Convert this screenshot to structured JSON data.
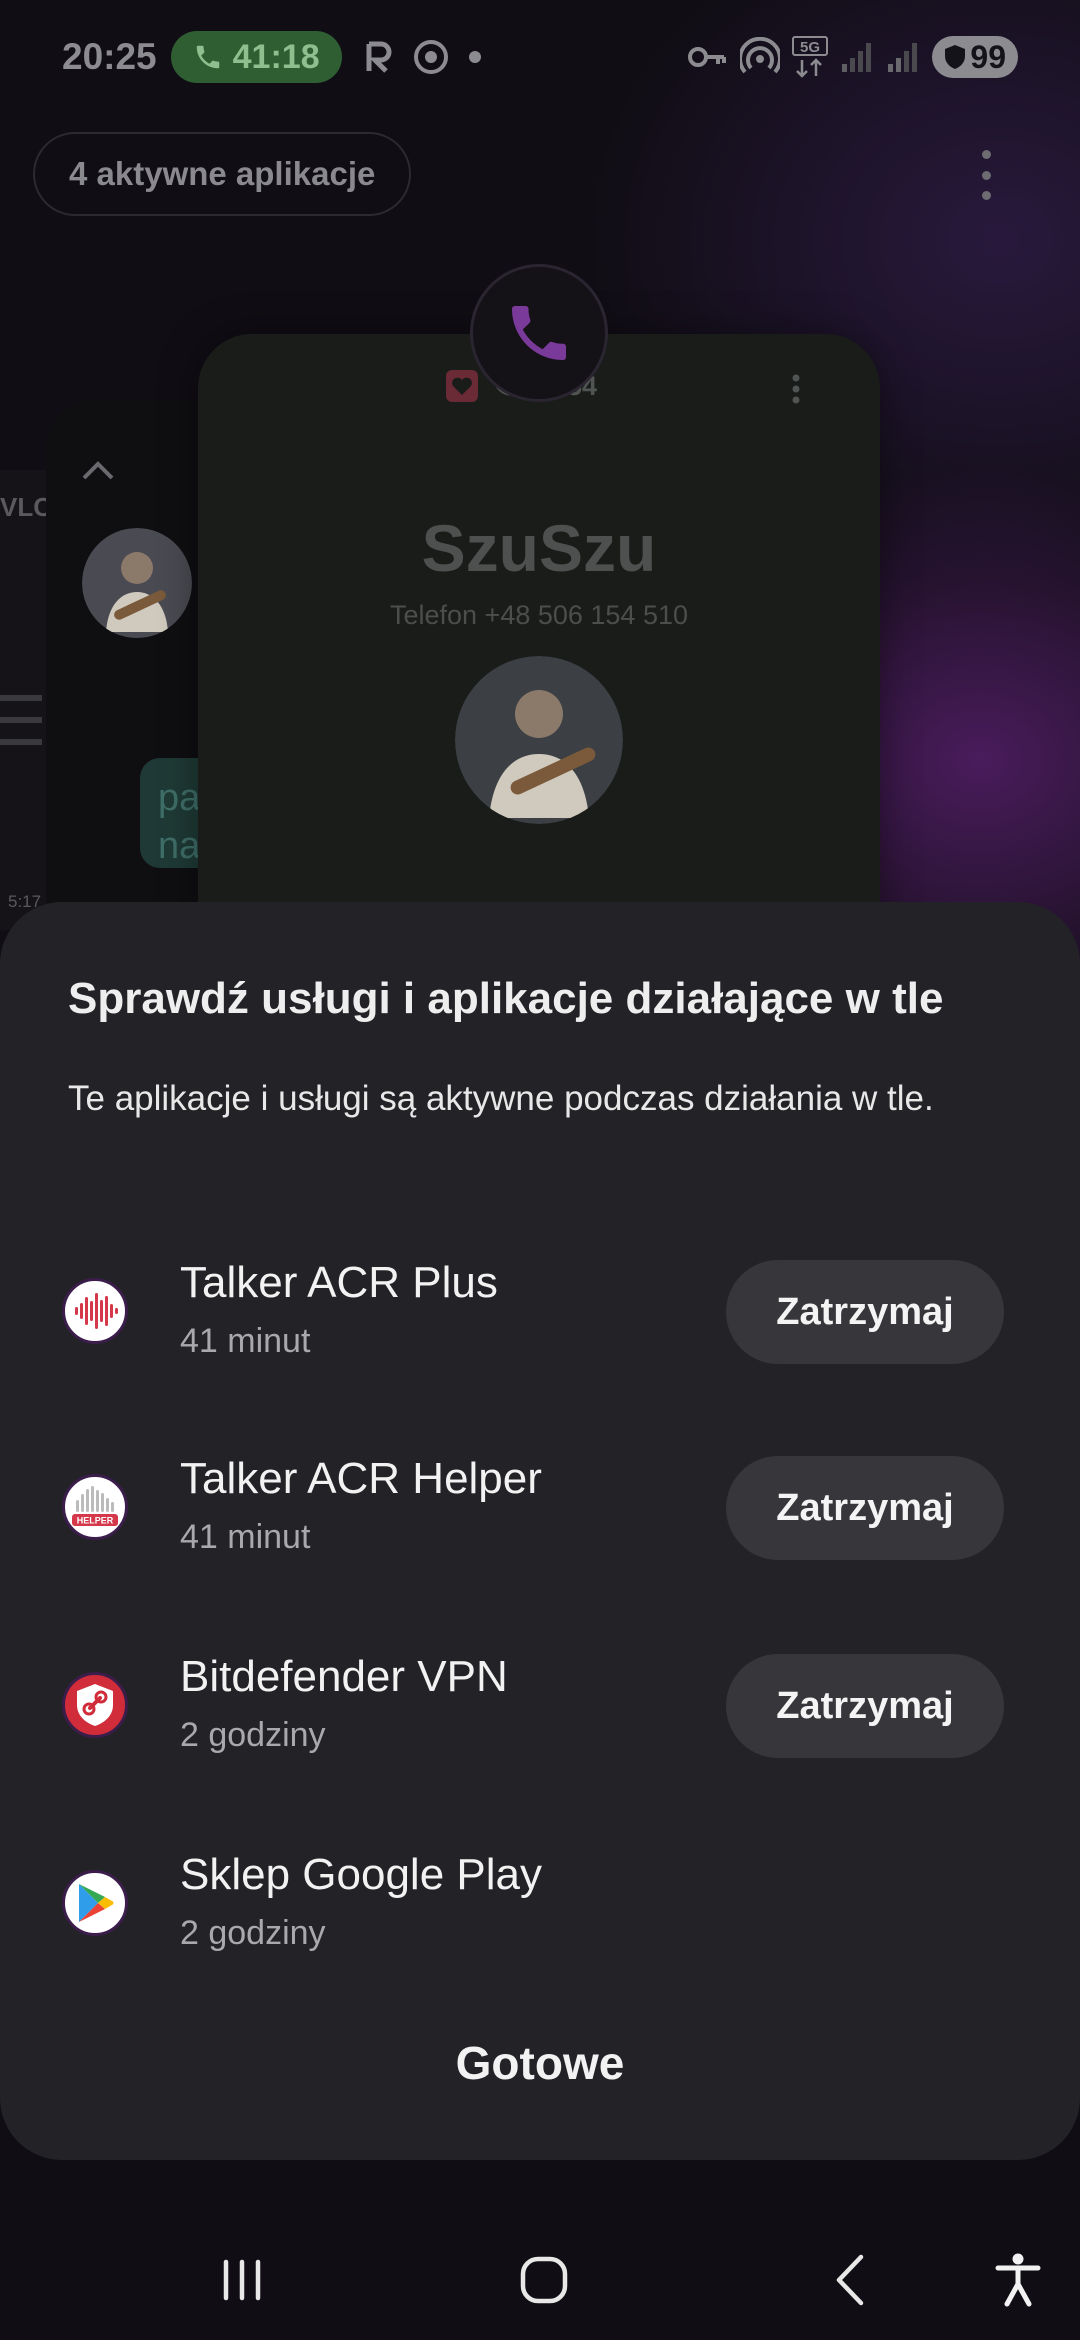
{
  "status_bar": {
    "time": "20:25",
    "call_timer": "41:18",
    "battery": "99"
  },
  "recents": {
    "active_apps_label": "4 aktywne aplikacje",
    "far_card": {
      "label": "VLC",
      "time": "5:17"
    },
    "mid_card": {
      "bubble_text": "pa na"
    },
    "main_card": {
      "call_time": "59:54",
      "contact_name": "SzuSzu",
      "contact_number": "Telefon +48 506 154 510"
    }
  },
  "sheet": {
    "title": "Sprawdź usługi i aplikacje działające w tle",
    "description": "Te aplikacje i usługi są aktywne podczas działania w tle.",
    "apps": [
      {
        "name": "Talker ACR Plus",
        "duration": "41 minut",
        "action": "Zatrzymaj",
        "icon": "talker-acr-plus-icon"
      },
      {
        "name": "Talker ACR Helper",
        "duration": "41 minut",
        "action": "Zatrzymaj",
        "icon": "talker-acr-helper-icon"
      },
      {
        "name": "Bitdefender VPN",
        "duration": "2 godziny",
        "action": "Zatrzymaj",
        "icon": "bitdefender-vpn-icon"
      },
      {
        "name": "Sklep Google Play",
        "duration": "2 godziny",
        "icon": "google-play-icon"
      }
    ],
    "done_label": "Gotowe"
  },
  "helper_badge": "HELPER",
  "colors": {
    "sheet_bg": "#232226",
    "button_bg": "#37363a",
    "call_chip_bg": "#2f5e32",
    "talker_red": "#d4384a",
    "bitdefender_red": "#d12c3a"
  }
}
